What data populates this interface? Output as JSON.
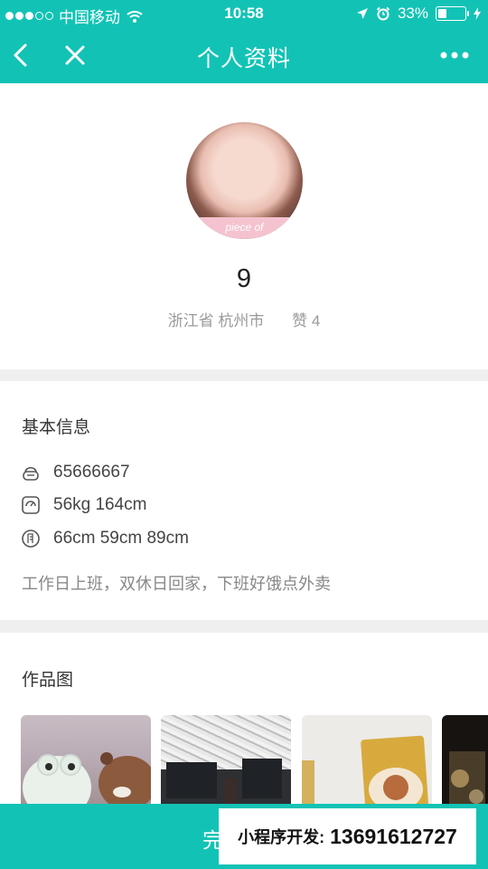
{
  "status_bar": {
    "carrier": "中国移动",
    "time": "10:58",
    "battery_percent": "33%",
    "battery_level": 0.33,
    "icons": [
      "signal-dots",
      "wifi-icon",
      "location-arrow-icon",
      "alarm-icon",
      "battery-icon",
      "charging-icon"
    ]
  },
  "nav": {
    "title": "个人资料",
    "icons": [
      "back-chevron-icon",
      "close-icon",
      "more-icon"
    ]
  },
  "profile": {
    "avatar_caption": "piece of",
    "nickname": "9",
    "location": "浙江省 杭州市",
    "likes": "赞 4"
  },
  "basic_info": {
    "title": "基本信息",
    "rows": [
      {
        "icon": "user-id-icon",
        "text": "65666667"
      },
      {
        "icon": "scale-icon",
        "text": "56kg 164cm"
      },
      {
        "icon": "measure-icon",
        "text": "66cm 59cm 89cm"
      }
    ],
    "intro": "工作日上班，双休日回家，下班好饿点外卖"
  },
  "works": {
    "title": "作品图",
    "thumbnails": [
      "plush-toys-photo",
      "newspaper-lipstick-photo",
      "gold-package-photo",
      "glassware-photo"
    ]
  },
  "bottom_bar": {
    "done_label": "完"
  },
  "contact_overlay": {
    "label": "小程序开发:",
    "phone": "13691612727"
  },
  "colors": {
    "accent": "#12c3b5",
    "background": "#efefef",
    "card": "#ffffff"
  }
}
